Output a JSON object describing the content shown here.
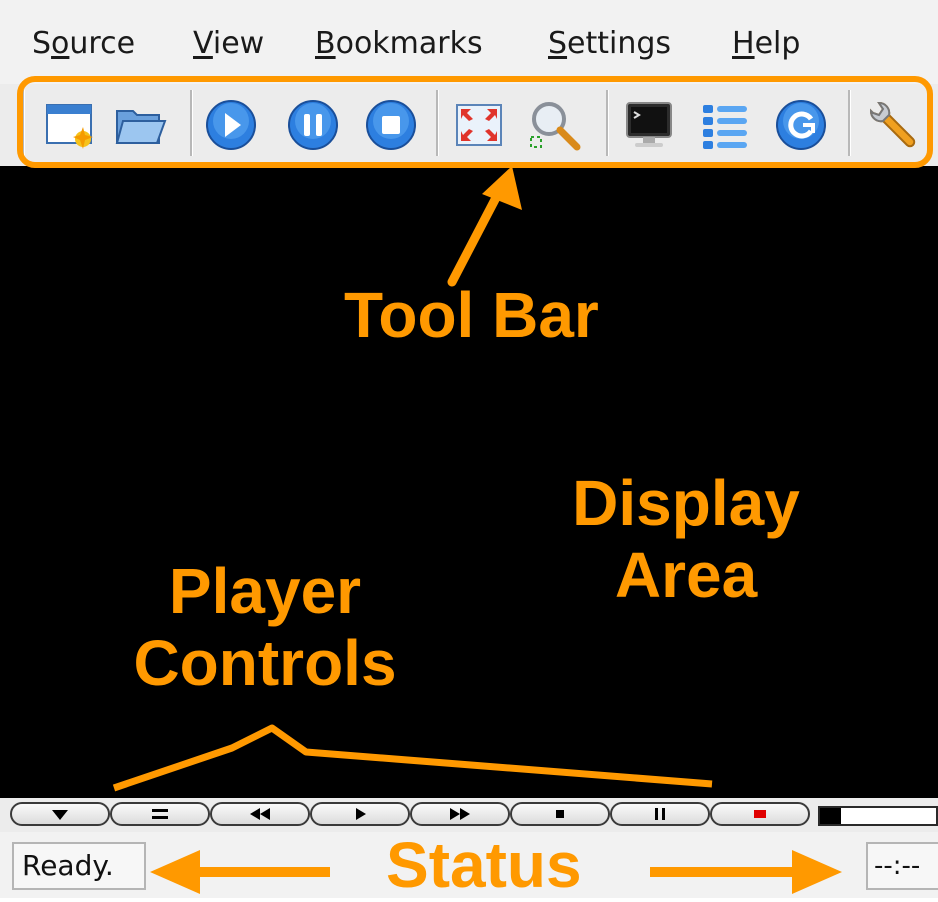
{
  "menubar": {
    "items": [
      {
        "prefix": "S",
        "accel": "o",
        "suffix": "urce"
      },
      {
        "prefix": "",
        "accel": "V",
        "suffix": "iew"
      },
      {
        "prefix": "",
        "accel": "B",
        "suffix": "ookmarks"
      },
      {
        "prefix": "",
        "accel": "S",
        "suffix": "ettings"
      },
      {
        "prefix": "",
        "accel": "H",
        "suffix": "elp"
      }
    ]
  },
  "toolbar": {
    "buttons": [
      "new-window-icon",
      "open-folder-icon",
      "play-icon",
      "pause-icon",
      "stop-icon",
      "fullscreen-icon",
      "zoom-icon",
      "console-icon",
      "playlist-icon",
      "refresh-icon",
      "settings-wrench-icon"
    ]
  },
  "annotations": {
    "toolbar": "Tool Bar",
    "display_line1": "Display",
    "display_line2": "Area",
    "controls_line1": "Player",
    "controls_line2": "Controls",
    "status": "Status",
    "color": "#ff9900"
  },
  "controls": {
    "buttons": [
      "menu-arrow",
      "equalizer",
      "rewind",
      "play",
      "fast-forward",
      "stop",
      "pause",
      "record"
    ],
    "seek_progress": 0.18
  },
  "status": {
    "text": "Ready.",
    "time": "--:--"
  }
}
